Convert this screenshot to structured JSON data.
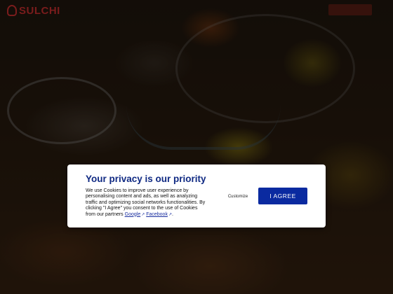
{
  "header": {
    "logo_text": "SULCHI",
    "logo_icon": "brand-logo-icon"
  },
  "cookie_banner": {
    "title": "Your privacy is our priority",
    "body_text": "We use Cookies to improve user experience by personalising content and ads, as well as analyzing traffic and optimizing social networks functionalities. By clicking \"I Agree\" you consent to the use of Cookies from our partners",
    "link_google": "Google",
    "separator": " ",
    "link_facebook": "Facebook",
    "end_punct": ".",
    "external_link_icon": "external-link-icon",
    "customize_label": "Customize",
    "agree_label": "I AGREE",
    "accent_color": "#0a2aa0",
    "title_color": "#102a83"
  }
}
